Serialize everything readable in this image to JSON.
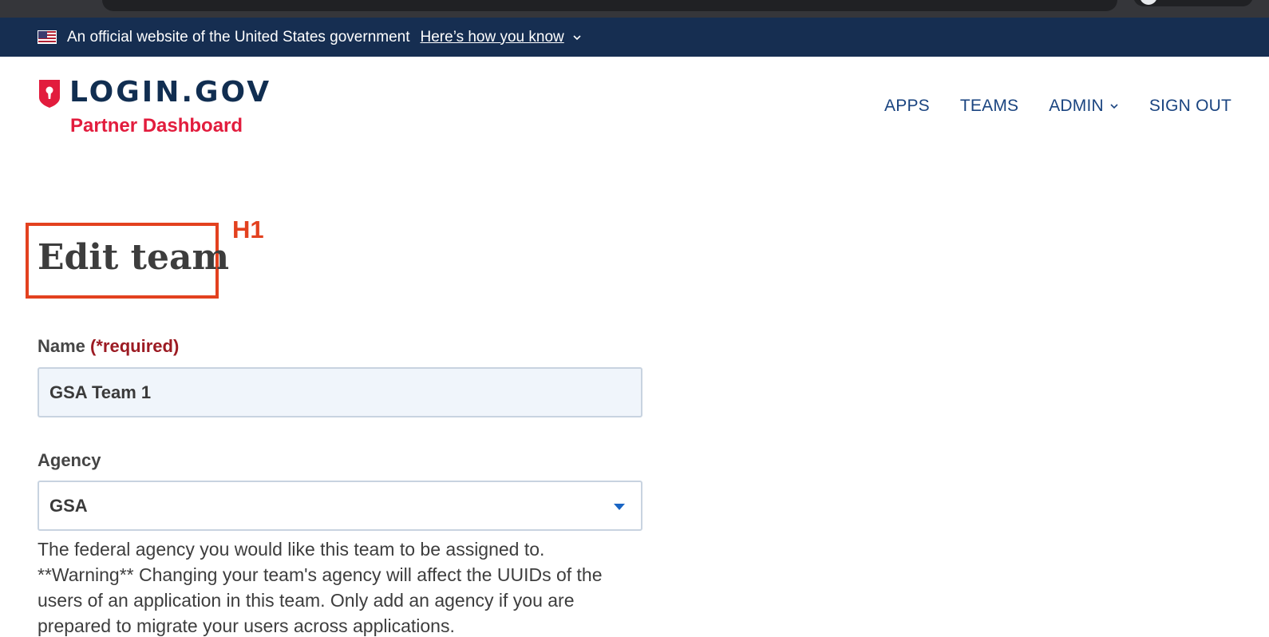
{
  "banner": {
    "official_text": "An official website of the United States government",
    "how_link": "Here’s how you know"
  },
  "header": {
    "logo_text": "LOGIN.GOV",
    "logo_subtitle": "Partner Dashboard",
    "nav": {
      "apps": "APPS",
      "teams": "TEAMS",
      "admin": "ADMIN",
      "sign_out": "SIGN OUT"
    }
  },
  "annotation": {
    "tag": "H1",
    "color": "#e3411f"
  },
  "main": {
    "title": "Edit team",
    "name_label": "Name",
    "name_required": "(*required)",
    "name_value": "GSA Team 1",
    "agency_label": "Agency",
    "agency_value": "GSA",
    "agency_help_line1": "The federal agency you would like this team to be assigned to.",
    "agency_help_line2": "**Warning** Changing your team's agency will affect the UUIDs of the users of an application in this team. Only add an agency if you are prepared to migrate your users across applications."
  },
  "colors": {
    "banner_bg": "#162e51",
    "brand_navy": "#112e51",
    "brand_red": "#e21c3d",
    "nav_link": "#1a4480",
    "required": "#9c1b23"
  }
}
